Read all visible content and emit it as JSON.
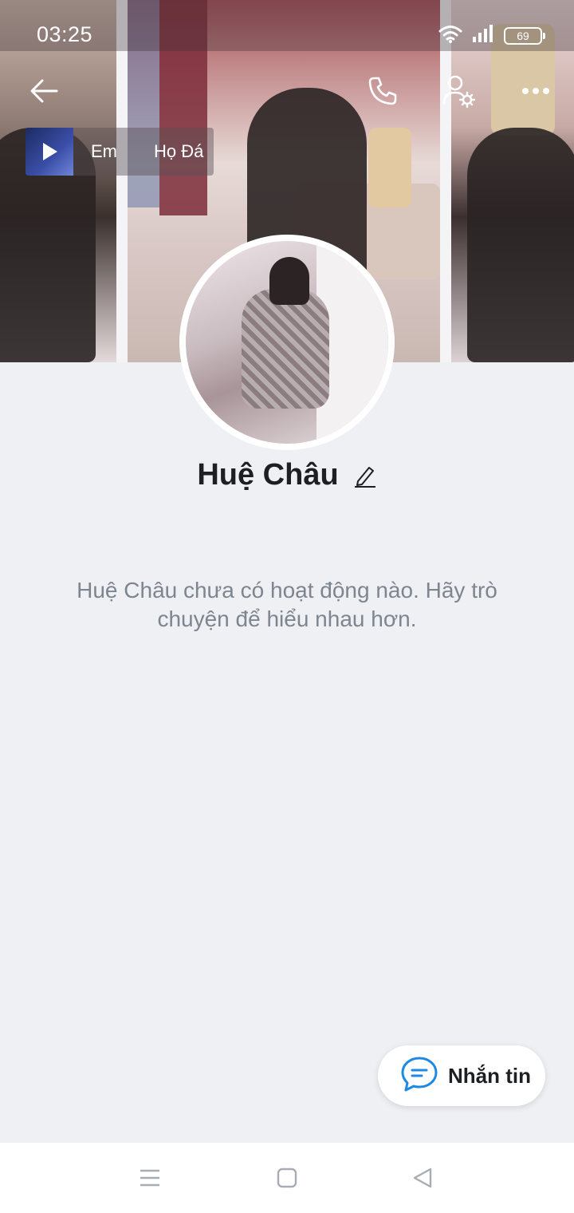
{
  "status_bar": {
    "time": "03:25",
    "battery": "69",
    "icons": [
      "wifi-icon",
      "signal-icon",
      "battery-icon"
    ]
  },
  "top_bar": {
    "icons": [
      "back-arrow-icon",
      "phone-icon",
      "user-settings-icon",
      "more-icon"
    ]
  },
  "music": {
    "thumbnail_icon": "play-icon",
    "title": "Em",
    "artist": "Họ Đá"
  },
  "profile": {
    "name": "Huệ Châu",
    "edit_icon": "pencil-icon",
    "empty_message": "Huệ Châu chưa có hoạt động nào. Hãy trò chuyện để hiểu nhau hơn."
  },
  "message_button": {
    "label": "Nhắn tin",
    "icon": "chat-bubble-icon"
  },
  "nav_bar": {
    "icons": [
      "menu-icon",
      "home-icon",
      "back-icon"
    ]
  },
  "colors": {
    "background": "#eff0f4",
    "accent": "#1e88e5",
    "text_primary": "#1d1f23",
    "text_secondary": "#7d8590"
  }
}
